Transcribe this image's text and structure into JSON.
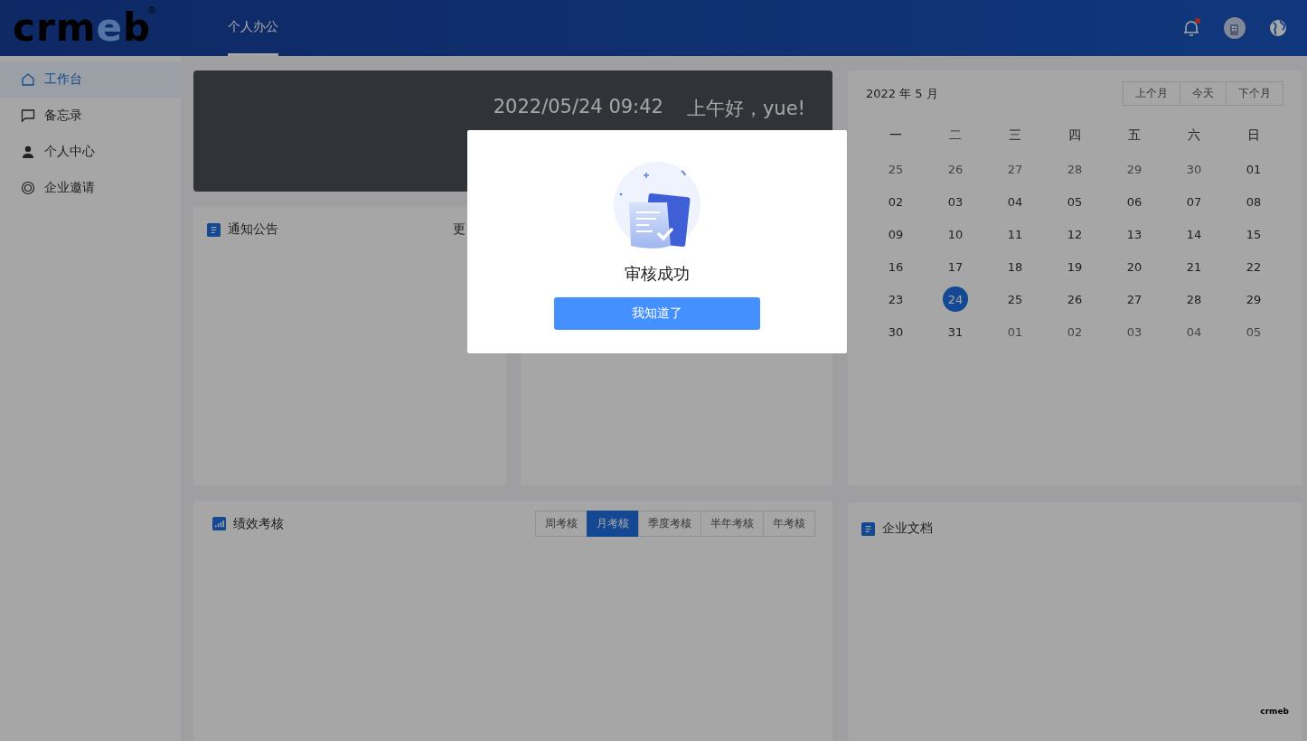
{
  "header": {
    "logo": "crmeb",
    "logo_mark": "®",
    "tabs": [
      {
        "label": "个人办公",
        "selected": true
      }
    ],
    "notification_unread": true
  },
  "sidebar": {
    "items": [
      {
        "label": "工作台",
        "selected": true
      },
      {
        "label": "备忘录",
        "selected": false
      },
      {
        "label": "个人中心",
        "selected": false
      },
      {
        "label": "企业邀请",
        "selected": false
      }
    ]
  },
  "banner": {
    "datetime": "2022/05/24 09:42",
    "greeting": "上午好，yue!"
  },
  "notice_card": {
    "title": "通知公告",
    "more": "更"
  },
  "calendar": {
    "title": "2022 年 5 月",
    "buttons": [
      "上个月",
      "今天",
      "下个月"
    ],
    "weekdays": [
      "一",
      "二",
      "三",
      "四",
      "五",
      "六",
      "日"
    ],
    "weeks": [
      [
        {
          "day": "25",
          "muted": true,
          "selected": false
        },
        {
          "day": "26",
          "muted": true,
          "selected": false
        },
        {
          "day": "27",
          "muted": true,
          "selected": false
        },
        {
          "day": "28",
          "muted": true,
          "selected": false
        },
        {
          "day": "29",
          "muted": true,
          "selected": false
        },
        {
          "day": "30",
          "muted": true,
          "selected": false
        },
        {
          "day": "01",
          "muted": false,
          "selected": false
        }
      ],
      [
        {
          "day": "02",
          "muted": false,
          "selected": false
        },
        {
          "day": "03",
          "muted": false,
          "selected": false
        },
        {
          "day": "04",
          "muted": false,
          "selected": false
        },
        {
          "day": "05",
          "muted": false,
          "selected": false
        },
        {
          "day": "06",
          "muted": false,
          "selected": false
        },
        {
          "day": "07",
          "muted": false,
          "selected": false
        },
        {
          "day": "08",
          "muted": false,
          "selected": false
        }
      ],
      [
        {
          "day": "09",
          "muted": false,
          "selected": false
        },
        {
          "day": "10",
          "muted": false,
          "selected": false
        },
        {
          "day": "11",
          "muted": false,
          "selected": false
        },
        {
          "day": "12",
          "muted": false,
          "selected": false
        },
        {
          "day": "13",
          "muted": false,
          "selected": false
        },
        {
          "day": "14",
          "muted": false,
          "selected": false
        },
        {
          "day": "15",
          "muted": false,
          "selected": false
        }
      ],
      [
        {
          "day": "16",
          "muted": false,
          "selected": false
        },
        {
          "day": "17",
          "muted": false,
          "selected": false
        },
        {
          "day": "18",
          "muted": false,
          "selected": false
        },
        {
          "day": "19",
          "muted": false,
          "selected": false
        },
        {
          "day": "20",
          "muted": false,
          "selected": false
        },
        {
          "day": "21",
          "muted": false,
          "selected": false
        },
        {
          "day": "22",
          "muted": false,
          "selected": false
        }
      ],
      [
        {
          "day": "23",
          "muted": false,
          "selected": false
        },
        {
          "day": "24",
          "muted": false,
          "selected": true
        },
        {
          "day": "25",
          "muted": false,
          "selected": false
        },
        {
          "day": "26",
          "muted": false,
          "selected": false
        },
        {
          "day": "27",
          "muted": false,
          "selected": false
        },
        {
          "day": "28",
          "muted": false,
          "selected": false
        },
        {
          "day": "29",
          "muted": false,
          "selected": false
        }
      ],
      [
        {
          "day": "30",
          "muted": false,
          "selected": false
        },
        {
          "day": "31",
          "muted": false,
          "selected": false
        },
        {
          "day": "01",
          "muted": true,
          "selected": false
        },
        {
          "day": "02",
          "muted": true,
          "selected": false
        },
        {
          "day": "03",
          "muted": true,
          "selected": false
        },
        {
          "day": "04",
          "muted": true,
          "selected": false
        },
        {
          "day": "05",
          "muted": true,
          "selected": false
        }
      ]
    ]
  },
  "performance_card": {
    "title": "绩效考核",
    "tabs": [
      {
        "label": "周考核",
        "selected": false
      },
      {
        "label": "月考核",
        "selected": true
      },
      {
        "label": "季度考核",
        "selected": false
      },
      {
        "label": "半年考核",
        "selected": false
      },
      {
        "label": "年考核",
        "selected": false
      }
    ]
  },
  "documents_card": {
    "title": "企业文档"
  },
  "corner_logo": "crmeb",
  "dialog": {
    "message": "审核成功",
    "button": "我知道了"
  }
}
